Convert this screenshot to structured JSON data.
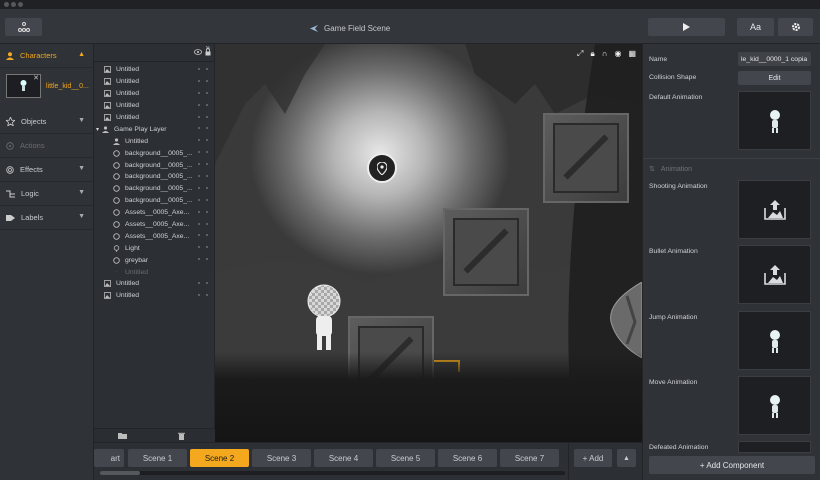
{
  "toolbar": {
    "scene_title": "Game Field Scene",
    "text_button": "Aa"
  },
  "sidebar": {
    "characters_label": "Characters",
    "character_name": "little_kid__0...",
    "items": [
      {
        "label": "Objects"
      },
      {
        "label": "Actions"
      },
      {
        "label": "Effects"
      },
      {
        "label": "Logic"
      },
      {
        "label": "Labels"
      }
    ]
  },
  "layers": {
    "top": [
      "Untitled",
      "Untitled",
      "Untitled",
      "Untitled",
      "Untitled"
    ],
    "group_label": "Game Play Layer",
    "children": [
      "Untitled",
      "background__0005_...",
      "background__0005_...",
      "background__0005_...",
      "background__0005_...",
      "background__0005_...",
      "Assets__0005_Axe...",
      "Assets__0005_Axe...",
      "Assets__0005_Axe...",
      "Light",
      "greybar",
      "Untitled"
    ],
    "bottom": [
      "Untitled",
      "Untitled"
    ]
  },
  "inspector": {
    "name_label": "Name",
    "name_value": "le_kid__0000_1 copia",
    "collision_label": "Collision Shape",
    "edit_label": "Edit",
    "default_anim_label": "Default Animation",
    "animation_section": "Animation",
    "shooting_label": "Shooting Animation",
    "bullet_label": "Bullet Animation",
    "jump_label": "Jump Animation",
    "move_label": "Move Animation",
    "defeated_label": "Defeated Animation",
    "add_component": "+ Add Component"
  },
  "scenes": {
    "partial": "art",
    "tabs": [
      "Scene 1",
      "Scene 2",
      "Scene 3",
      "Scene 4",
      "Scene 5",
      "Scene 6",
      "Scene 7"
    ],
    "active_index": 1,
    "add_label": "+ Add"
  },
  "colors": {
    "accent": "#f3a81d",
    "panel": "#2f3237",
    "button": "#43474d"
  }
}
